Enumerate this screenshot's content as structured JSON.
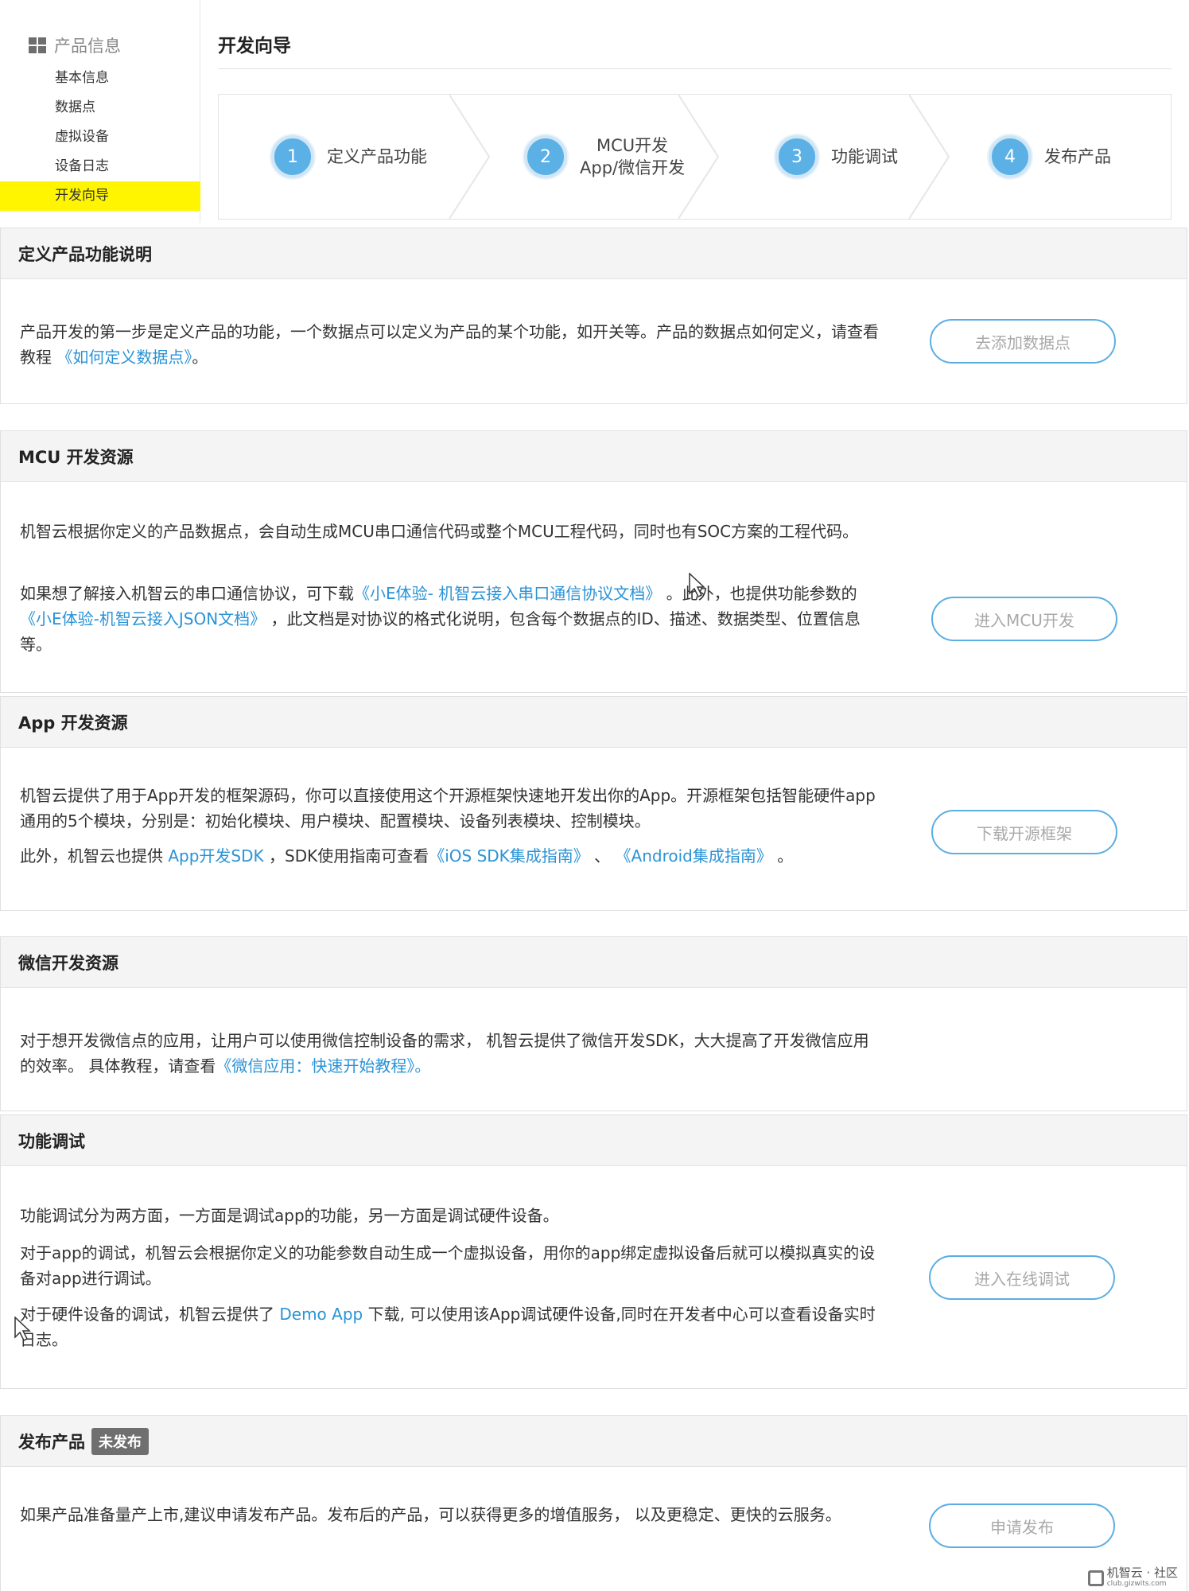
{
  "sidebar": {
    "header_icon": "grid-icon",
    "header": "产品信息",
    "items": [
      {
        "label": "基本信息",
        "active": false
      },
      {
        "label": "数据点",
        "active": false
      },
      {
        "label": "虚拟设备",
        "active": false
      },
      {
        "label": "设备日志",
        "active": false
      },
      {
        "label": "开发向导",
        "active": true
      }
    ],
    "active_color": "#fff500"
  },
  "page": {
    "title": "开发向导"
  },
  "steps": [
    {
      "num": "1",
      "line1": "定义产品功能",
      "line2": ""
    },
    {
      "num": "2",
      "line1": "MCU开发",
      "line2": "App/微信开发"
    },
    {
      "num": "3",
      "line1": "功能调试",
      "line2": ""
    },
    {
      "num": "4",
      "line1": "发布产品",
      "line2": ""
    }
  ],
  "sections": {
    "define": {
      "title": "定义产品功能说明",
      "p1_a": "产品开发的第一步是定义产品的功能，一个数据点可以定义为产品的某个功能，如开关等。产品的数据点如何定义，请查看教程",
      "p1_link": "《如何定义数据点》",
      "p1_b": "。",
      "button": "去添加数据点"
    },
    "mcu": {
      "title": "MCU 开发资源",
      "p1": "机智云根据你定义的产品数据点，会自动生成MCU串口通信代码或整个MCU工程代码，同时也有SOC方案的工程代码。",
      "p2_a": "如果想了解接入机智云的串口通信协议，可下载",
      "p2_link1": "《小E体验- 机智云接入串口通信协议文档》",
      "p2_b": "。此外，也提供功能参数的",
      "p2_link2": "《小E体验-机智云接入JSON文档》",
      "p2_c": "，此文档是对协议的格式化说明，包含每个数据点的ID、描述、数据类型、位置信息等。",
      "button": "进入MCU开发"
    },
    "app": {
      "title": "App 开发资源",
      "p1": "机智云提供了用于App开发的框架源码，你可以直接使用这个开源框架快速地开发出你的App。开源框架包括智能硬件app通用的5个模块，分别是：初始化模块、用户模块、配置模块、设备列表模块、控制模块。",
      "p2_a": "此外，机智云也提供",
      "p2_link1": "App开发SDK",
      "p2_b": "，SDK使用指南可查看",
      "p2_link2": "《iOS SDK集成指南》",
      "p2_c": "、",
      "p2_link3": "《Android集成指南》",
      "p2_d": "。",
      "button": "下载开源框架"
    },
    "wechat": {
      "title": "微信开发资源",
      "p1_a": "对于想开发微信点的应用，让用户可以使用微信控制设备的需求， 机智云提供了微信开发SDK，大大提高了开发微信应用的效率。 具体教程，请查看",
      "p1_link": "《微信应用：快速开始教程》。"
    },
    "debug": {
      "title": "功能调试",
      "p1": "功能调试分为两方面，一方面是调试app的功能，另一方面是调试硬件设备。",
      "p2": "对于app的调试，机智云会根据你定义的功能参数自动生成一个虚拟设备，用你的app绑定虚拟设备后就可以模拟真实的设备对app进行调试。",
      "p3_a": "对于硬件设备的调试，机智云提供了",
      "p3_link": "Demo App",
      "p3_b": "下载, 可以使用该App调试硬件设备,同时在开发者中心可以查看设备实时日志。",
      "button": "进入在线调试"
    },
    "publish": {
      "title": "发布产品",
      "badge": "未发布",
      "p1": "如果产品准备量产上市,建议申请发布产品。发布后的产品，可以获得更多的增值服务， 以及更稳定、更快的云服务。",
      "button": "申请发布"
    }
  },
  "colors": {
    "link": "#2a93d6",
    "step_circle": "#5bb0e6",
    "button_border": "#5aaee3"
  },
  "watermark": {
    "text": "机智云 · 社区",
    "sub": "club.gizwits.com"
  }
}
